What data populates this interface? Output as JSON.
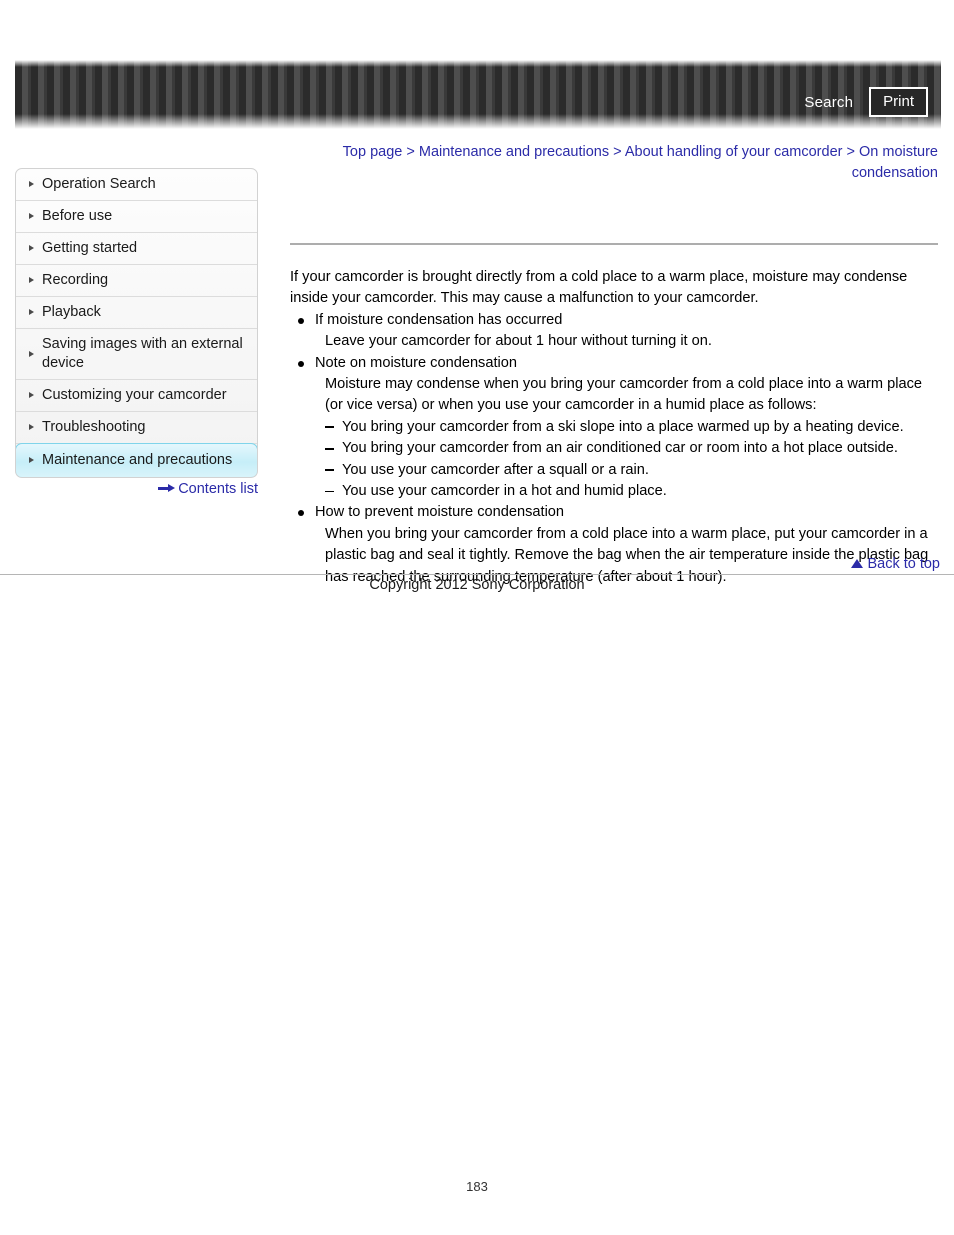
{
  "banner": {
    "search_label": "Search",
    "print_label": "Print",
    "icons": {
      "search": "search-icon",
      "print": "print-icon"
    },
    "colors": {
      "stripe_dark": "#2b2b2b",
      "stripe_light": "#4e4e4e",
      "text": "#ffffff"
    }
  },
  "breadcrumb": {
    "items": [
      {
        "label": "Top page"
      },
      {
        "label": "Maintenance and precautions"
      },
      {
        "label": "About handling of your camcorder"
      },
      {
        "label": "On moisture condensation"
      }
    ],
    "separator": ">",
    "link_color": "#2b2ba8"
  },
  "sidebar": {
    "items": [
      {
        "label": "Operation Search",
        "active": false
      },
      {
        "label": "Before use",
        "active": false
      },
      {
        "label": "Getting started",
        "active": false
      },
      {
        "label": "Recording",
        "active": false
      },
      {
        "label": "Playback",
        "active": false
      },
      {
        "label": "Saving images with an external device",
        "active": false
      },
      {
        "label": "Customizing your camcorder",
        "active": false
      },
      {
        "label": "Troubleshooting",
        "active": false
      },
      {
        "label": "Maintenance and precautions",
        "active": true
      }
    ],
    "contents_link": "Contents list",
    "active_color": "#c6eef8"
  },
  "content": {
    "intro": "If your camcorder is brought directly from a cold place to a warm place, moisture may condense inside your camcorder. This may cause a malfunction to your camcorder.",
    "bullets": [
      {
        "title": "If moisture condensation has occurred",
        "body": "Leave your camcorder for about 1 hour without turning it on.",
        "sub_items": []
      },
      {
        "title": "Note on moisture condensation",
        "body": "Moisture may condense when you bring your camcorder from a cold place into a warm place (or vice versa) or when you use your camcorder in a humid place as follows:",
        "sub_items": [
          "You bring your camcorder from a ski slope into a place warmed up by a heating device.",
          "You bring your camcorder from an air conditioned car or room into a hot place outside.",
          "You use your camcorder after a squall or a rain.",
          "You use your camcorder in a hot and humid place."
        ]
      },
      {
        "title": "How to prevent moisture condensation",
        "body": "When you bring your camcorder from a cold place into a warm place, put your camcorder in a plastic bag and seal it tightly. Remove the bag when the air temperature inside the plastic bag has reached the surrounding temperature (after about 1 hour).",
        "sub_items": []
      }
    ]
  },
  "back_to_top": {
    "label": "Back to top",
    "icon": "triangle-up-icon"
  },
  "footer": {
    "copyright": "Copyright 2012 Sony Corporation",
    "page_number": "183"
  }
}
